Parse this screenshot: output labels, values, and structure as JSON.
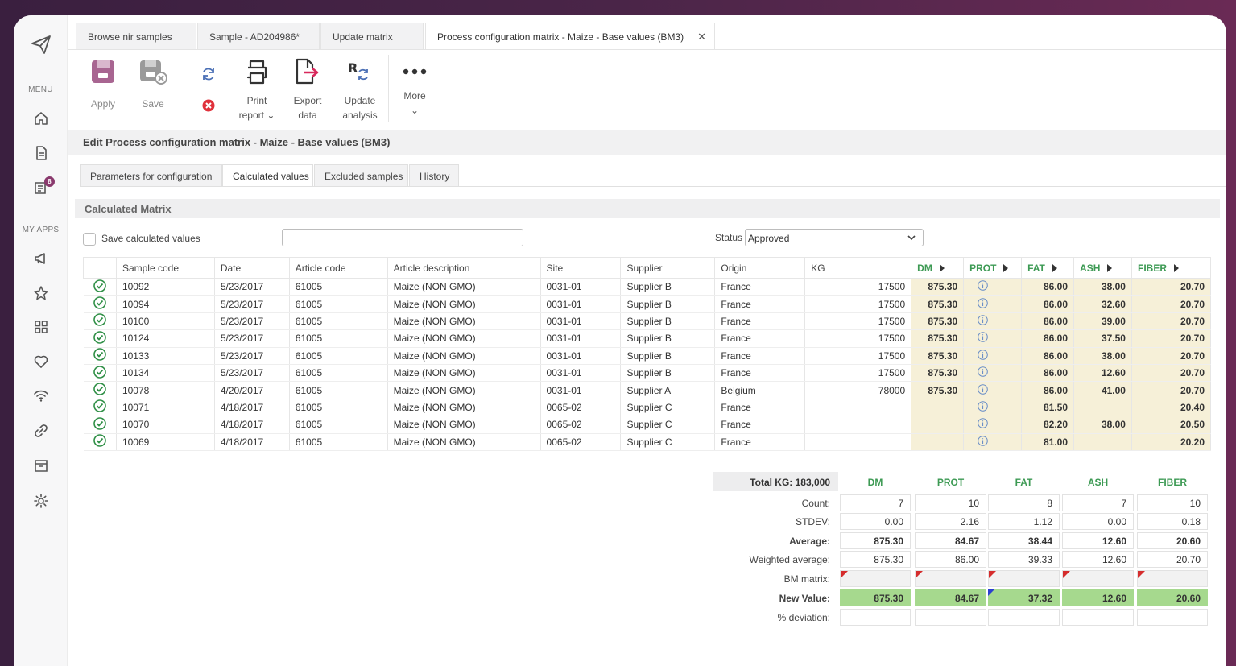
{
  "sidebar": {
    "menu_label": "MENU",
    "apps_label": "MY APPS",
    "badge_count": "8"
  },
  "tabs": [
    {
      "label": "Browse nir samples"
    },
    {
      "label": "Sample - AD204986*"
    },
    {
      "label": "Update matrix"
    },
    {
      "label": "Process configuration matrix - Maize - Base values (BM3)"
    }
  ],
  "toolbar": {
    "apply": "Apply",
    "save": "Save",
    "print": "Print",
    "report": "report",
    "export": "Export",
    "data": "data",
    "update": "Update",
    "analysis": "analysis",
    "more": "More"
  },
  "header": {
    "title": "Edit Process configuration matrix - Maize - Base values (BM3)"
  },
  "subtabs": [
    {
      "label": "Parameters for configuration"
    },
    {
      "label": "Calculated values"
    },
    {
      "label": "Excluded samples"
    },
    {
      "label": "History"
    }
  ],
  "section": {
    "title": "Calculated Matrix"
  },
  "controls": {
    "save_calc_label": "Save calculated values",
    "status_label": "Status",
    "status_value": "Approved"
  },
  "table": {
    "columns": [
      "Sample code",
      "Date",
      "Article code",
      "Article description",
      "Site",
      "Supplier",
      "Origin",
      "KG",
      "DM",
      "PROT",
      "FAT",
      "ASH",
      "FIBER"
    ],
    "rows": [
      [
        "10092",
        "5/23/2017",
        "61005",
        "Maize (NON GMO)",
        "0031-01",
        "Supplier B",
        "France",
        "17500",
        "875.30",
        "",
        "86.00",
        "38.00",
        "20.70"
      ],
      [
        "10094",
        "5/23/2017",
        "61005",
        "Maize (NON GMO)",
        "0031-01",
        "Supplier B",
        "France",
        "17500",
        "875.30",
        "",
        "86.00",
        "32.60",
        "20.70"
      ],
      [
        "10100",
        "5/23/2017",
        "61005",
        "Maize (NON GMO)",
        "0031-01",
        "Supplier B",
        "France",
        "17500",
        "875.30",
        "",
        "86.00",
        "39.00",
        "20.70"
      ],
      [
        "10124",
        "5/23/2017",
        "61005",
        "Maize (NON GMO)",
        "0031-01",
        "Supplier B",
        "France",
        "17500",
        "875.30",
        "",
        "86.00",
        "37.50",
        "20.70"
      ],
      [
        "10133",
        "5/23/2017",
        "61005",
        "Maize (NON GMO)",
        "0031-01",
        "Supplier B",
        "France",
        "17500",
        "875.30",
        "",
        "86.00",
        "38.00",
        "20.70"
      ],
      [
        "10134",
        "5/23/2017",
        "61005",
        "Maize (NON GMO)",
        "0031-01",
        "Supplier B",
        "France",
        "17500",
        "875.30",
        "",
        "86.00",
        "12.60",
        "20.70"
      ],
      [
        "10078",
        "4/20/2017",
        "61005",
        "Maize (NON GMO)",
        "0031-01",
        "Supplier A",
        "Belgium",
        "78000",
        "875.30",
        "",
        "86.00",
        "41.00",
        "20.70"
      ],
      [
        "10071",
        "4/18/2017",
        "61005",
        "Maize (NON GMO)",
        "0065-02",
        "Supplier C",
        "France",
        "",
        "",
        "",
        "81.50",
        "",
        "20.40"
      ],
      [
        "10070",
        "4/18/2017",
        "61005",
        "Maize (NON GMO)",
        "0065-02",
        "Supplier C",
        "France",
        "",
        "",
        "",
        "82.20",
        "38.00",
        "20.50"
      ],
      [
        "10069",
        "4/18/2017",
        "61005",
        "Maize (NON GMO)",
        "0065-02",
        "Supplier C",
        "France",
        "",
        "",
        "",
        "81.00",
        "",
        "20.20"
      ]
    ]
  },
  "stats": {
    "total_kg": "Total KG: 183,000",
    "columns": [
      "DM",
      "PROT",
      "FAT",
      "ASH",
      "FIBER"
    ],
    "labels": {
      "count": "Count:",
      "stdev": "STDEV:",
      "average": "Average:",
      "weighted": "Weighted average:",
      "bm": "BM matrix:",
      "newv": "New Value:",
      "dev": "% deviation:"
    },
    "count": [
      "7",
      "10",
      "8",
      "7",
      "10"
    ],
    "stdev": [
      "0.00",
      "2.16",
      "1.12",
      "0.00",
      "0.18"
    ],
    "average": [
      "875.30",
      "84.67",
      "38.44",
      "12.60",
      "20.60"
    ],
    "weighted": [
      "875.30",
      "86.00",
      "39.33",
      "12.60",
      "20.70"
    ],
    "newv": [
      "875.30",
      "84.67",
      "37.32",
      "12.60",
      "20.60"
    ]
  },
  "colors": {
    "accent_green": "#3d9a54",
    "highlight_yellow": "#f6f0d8",
    "new_value_green": "#a6d98e",
    "error_red": "#d52d2d",
    "brand_purple": "#8a3a6e"
  }
}
